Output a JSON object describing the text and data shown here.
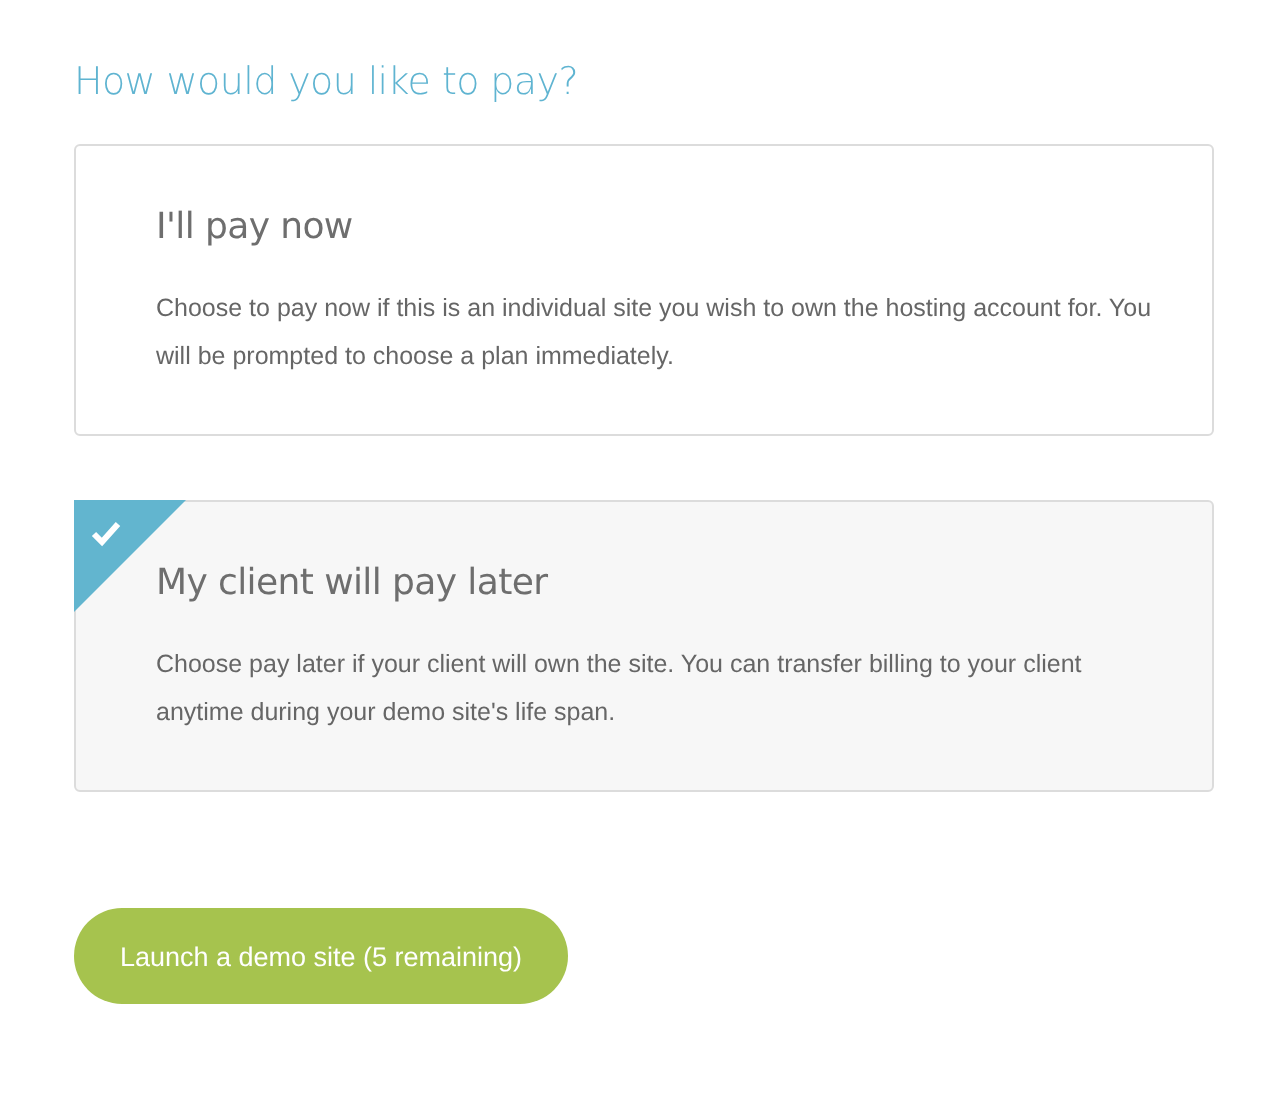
{
  "heading": "How would you like to pay?",
  "options": [
    {
      "title": "I'll pay now",
      "description": "Choose to pay now if this is an individual site you wish to own the hosting account for. You will be prompted to choose a plan immediately.",
      "selected": false
    },
    {
      "title": "My client will pay later",
      "description": "Choose pay later if your client will own the site. You can transfer billing to your client anytime during your demo site's life span.",
      "selected": true
    }
  ],
  "button": "Launch a demo site (5 remaining)"
}
